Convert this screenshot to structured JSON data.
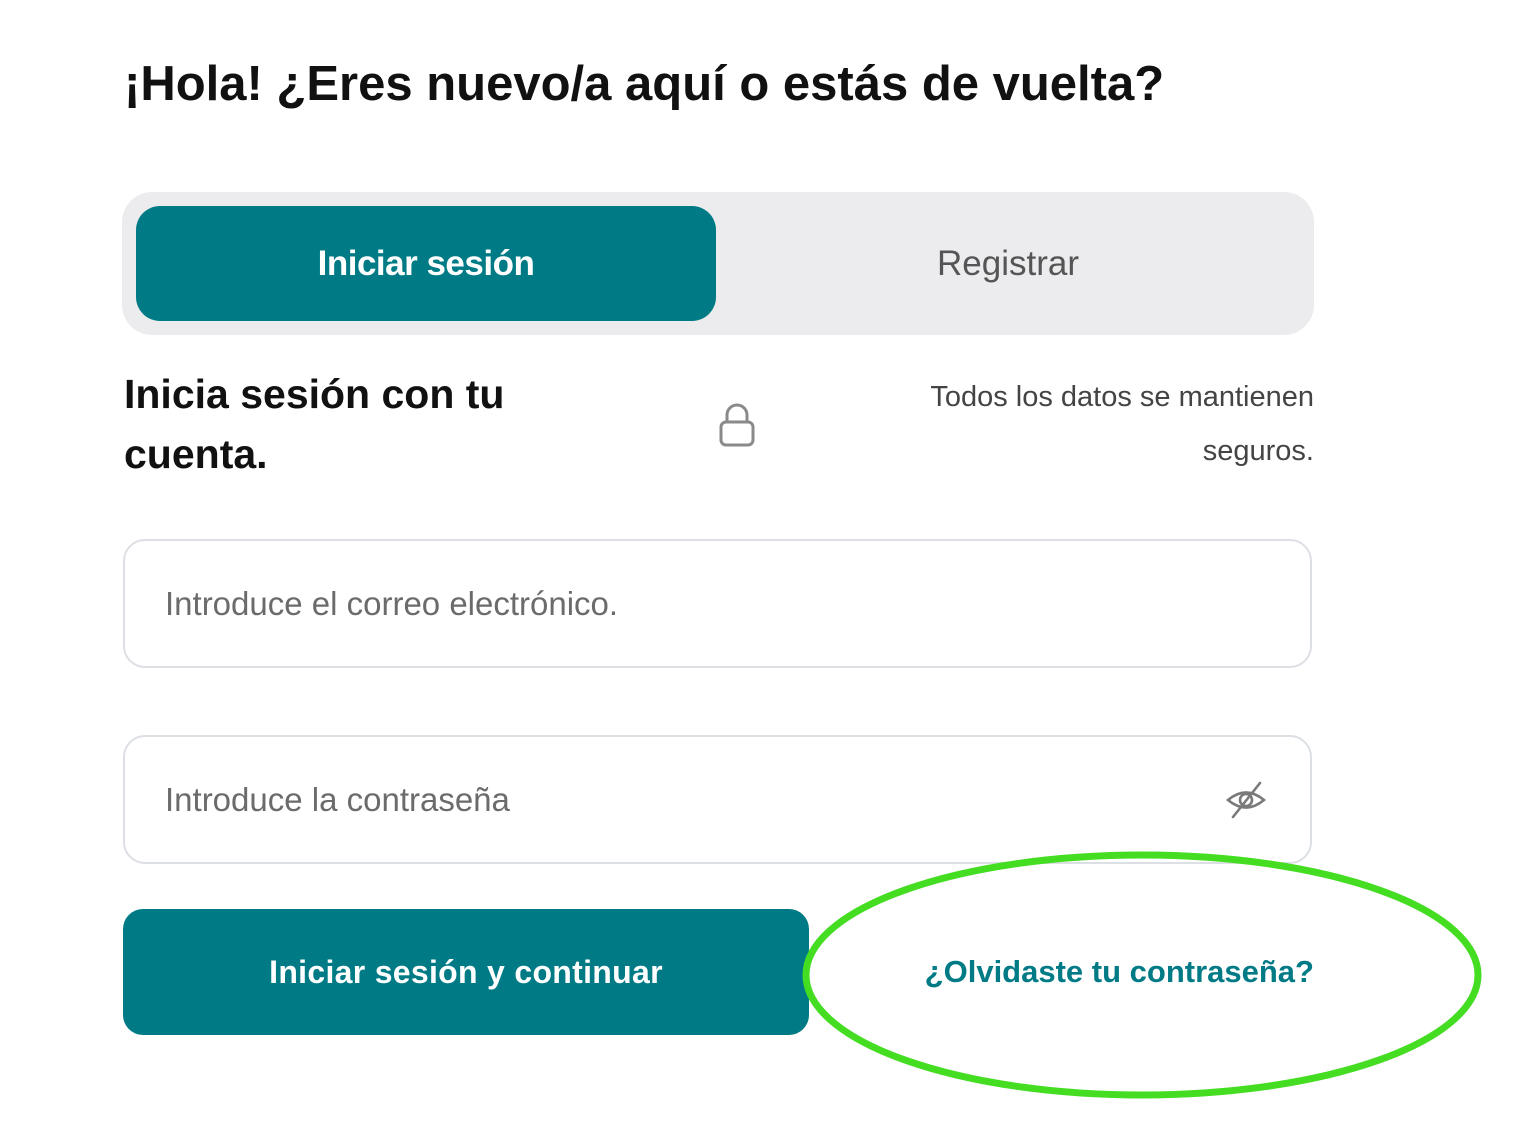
{
  "header": {
    "greeting": "¡Hola! ¿Eres nuevo/a aquí o estás de vuelta?"
  },
  "tabs": {
    "login_label": "Iniciar sesión",
    "register_label": "Registrar",
    "active": "login"
  },
  "login_section": {
    "title": "Inicia sesión con tu cuenta.",
    "secure_note": "Todos los datos se mantienen seguros.",
    "icon": "lock-icon"
  },
  "form": {
    "email_placeholder": "Introduce el correo electrónico.",
    "email_value": "",
    "password_placeholder": "Introduce la contraseña",
    "password_value": "",
    "password_toggle_icon": "eye-slash-icon",
    "submit_label": "Iniciar sesión y continuar",
    "forgot_label": "¿Olvidaste tu contraseña?"
  },
  "colors": {
    "accent": "#007b86",
    "tab_bar_bg": "#ececee",
    "highlight": "#44dd22"
  }
}
